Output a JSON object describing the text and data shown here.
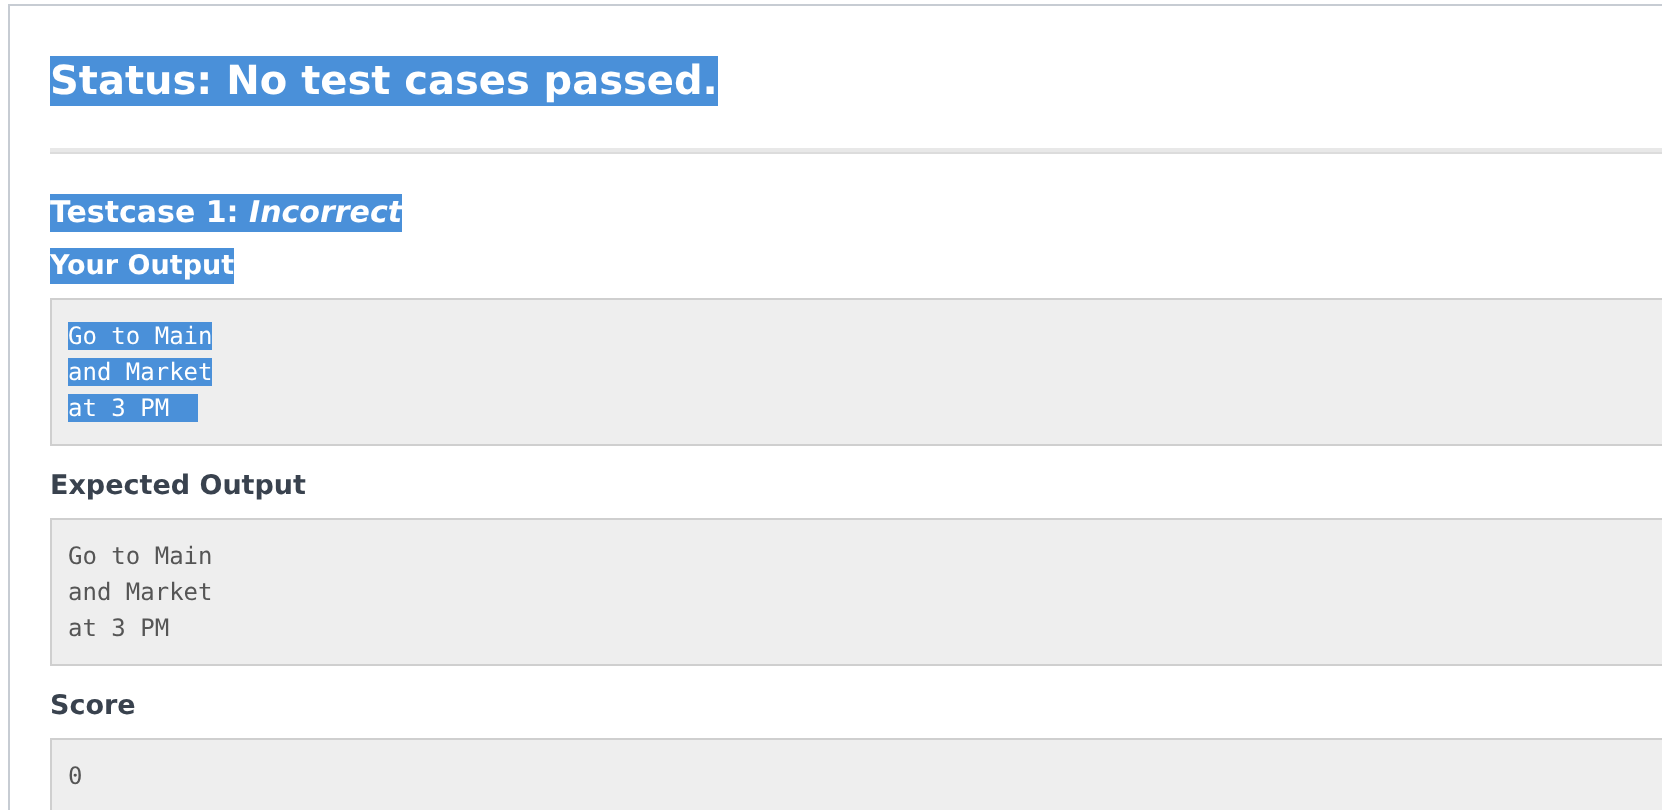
{
  "status": {
    "text": "Status: No test cases passed.",
    "highlighted": true
  },
  "testcase": {
    "title": "Testcase 1: *Incorrect*",
    "highlighted": true
  },
  "sections": [
    {
      "label": "Your Output",
      "highlighted": true,
      "lines": [
        {
          "text": "Go to Main",
          "highlighted": true
        },
        {
          "text": "and Market",
          "highlighted": true
        },
        {
          "text": "at 3 PM  ",
          "highlighted": true
        }
      ]
    },
    {
      "label": "Expected Output",
      "highlighted": false,
      "lines": [
        {
          "text": "Go to Main",
          "highlighted": false
        },
        {
          "text": "and Market",
          "highlighted": false
        },
        {
          "text": "at 3 PM",
          "highlighted": false
        }
      ]
    },
    {
      "label": "Score",
      "highlighted": false,
      "lines": [
        {
          "text": "0",
          "highlighted": false
        }
      ]
    }
  ]
}
